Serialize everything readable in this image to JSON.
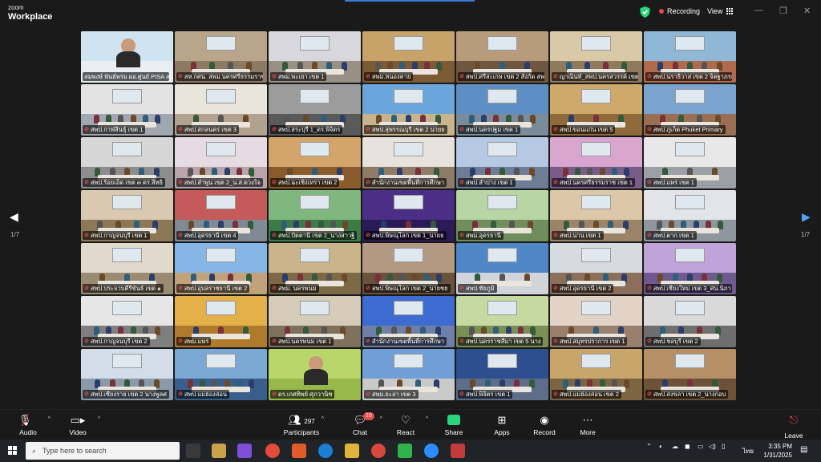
{
  "app": {
    "brand_small": "zoom",
    "brand_big": "Workplace",
    "recording_label": "Recording",
    "view_label": "View"
  },
  "gallery": {
    "page_indicator_left": "1/7",
    "page_indicator_right": "1/7",
    "tiles": [
      {
        "label": "สมพงษ์ พันธ์พรม ผอ.ศูนย์ PISA สพฐ.",
        "kind": "portrait",
        "wall": "#cfe3f0",
        "floor": "#e8eef2",
        "muted": false
      },
      {
        "label": "สห.กศน. สพม.นครศรีธรรมราช",
        "kind": "room",
        "wall": "#b9a58a",
        "floor": "#8c7a63",
        "muted": true
      },
      {
        "label": "สพม.พะเยา เขต 1",
        "kind": "room",
        "wall": "#d8d8dc",
        "floor": "#9a8f84",
        "muted": true
      },
      {
        "label": "สพม.หนองคาย",
        "kind": "room",
        "wall": "#c7a36a",
        "floor": "#7c5a34",
        "muted": true
      },
      {
        "label": "สพป.ศรีสะเกษ เขต 2 สังกัด สพฐ.",
        "kind": "room",
        "wall": "#b89b7b",
        "floor": "#6e5640",
        "muted": true
      },
      {
        "label": "ญาณินท์_สพป.นครสวรรค์ เขต 1",
        "kind": "room",
        "wall": "#d9c9a6",
        "floor": "#8f7a5d",
        "muted": true
      },
      {
        "label": "สพป.นราธิวาส เขต 2 จิตฐาภรณ์",
        "kind": "room",
        "wall": "#8fb7d6",
        "floor": "#b06a4c",
        "muted": true
      },
      {
        "label": "สพป.กาฬสินธุ์ เขต 1",
        "kind": "room",
        "wall": "#e3e3e3",
        "floor": "#a0a7ae",
        "muted": true
      },
      {
        "label": "สพป.สกลนคร เขต 3",
        "kind": "room",
        "wall": "#e9e4dc",
        "floor": "#b2a18f",
        "muted": true
      },
      {
        "label": "สพป.สระบุรี 1_ดร.พิจิตร",
        "kind": "room",
        "wall": "#9c9c9c",
        "floor": "#5a5a5a",
        "muted": true
      },
      {
        "label": "สพป.สุพรรณบุรี เขต 2 นายธ",
        "kind": "room",
        "wall": "#6aa6dc",
        "floor": "#c9b38d",
        "muted": true
      },
      {
        "label": "สพป.นครปฐม เขต 1",
        "kind": "room",
        "wall": "#5d8fc4",
        "floor": "#7a8c99",
        "muted": true
      },
      {
        "label": "สพป.ขอนแก่น เขต 5",
        "kind": "room",
        "wall": "#cfa96a",
        "floor": "#8f6b3c",
        "muted": true
      },
      {
        "label": "สพป.ภูเก็ต Phuket Primary",
        "kind": "room",
        "wall": "#7aa4cf",
        "floor": "#9a6e52",
        "muted": true
      },
      {
        "label": "สพป.ร้อยเอ็ด เขต ๓ ดร.สิทธิ",
        "kind": "room",
        "wall": "#d6d6d6",
        "floor": "#8d8d8d",
        "muted": true
      },
      {
        "label": "สพป.ลำพูน เขต 2_น.ส.ดวงใจ",
        "kind": "room",
        "wall": "#e6dbe0",
        "floor": "#b9a4ac",
        "muted": true
      },
      {
        "label": "สพป.ฉะเชิงเทรา เขต 2",
        "kind": "room",
        "wall": "#d3a56a",
        "floor": "#8a5b2d",
        "muted": true
      },
      {
        "label": "สำนักงานเขตพื้นที่การศึกษา",
        "kind": "room",
        "wall": "#e7e3dc",
        "floor": "#8e7b67",
        "muted": true
      },
      {
        "label": "สพป.ลำปาง เขต 1",
        "kind": "room",
        "wall": "#b6c9e4",
        "floor": "#6d7d95",
        "muted": true
      },
      {
        "label": "สพป.นครศรีธรรมราช เขต 1",
        "kind": "room",
        "wall": "#d9a6d0",
        "floor": "#7a5c88",
        "muted": true
      },
      {
        "label": "สพป.แพร่ เขต 1",
        "kind": "room",
        "wall": "#e8e8e8",
        "floor": "#9aa0a6",
        "muted": true
      },
      {
        "label": "สพป.กาญจนบุรี เขต 1",
        "kind": "room",
        "wall": "#d8c9b0",
        "floor": "#8c7756",
        "muted": true
      },
      {
        "label": "สพป.อุดรธานี เขต 4",
        "kind": "room",
        "wall": "#c45a5a",
        "floor": "#7f8a95",
        "muted": true
      },
      {
        "label": "สพป.ปัตตานี เขต 2_นางสาวฐิ",
        "kind": "room",
        "wall": "#7fb77e",
        "floor": "#3c7a46",
        "muted": true
      },
      {
        "label": "สพป.พิษณุโลก เขต 1_นายธ",
        "kind": "room",
        "wall": "#4b2f86",
        "floor": "#2a1b58",
        "muted": true
      },
      {
        "label": "สพม.อุดรธานี",
        "kind": "room",
        "wall": "#b8d6a4",
        "floor": "#6f8e5c",
        "muted": true
      },
      {
        "label": "สพป.น่าน เขต 1",
        "kind": "room",
        "wall": "#dcc8a8",
        "floor": "#9b8467",
        "muted": true
      },
      {
        "label": "สพป.ตาก เขต 1",
        "kind": "room",
        "wall": "#e2e4e8",
        "floor": "#8e969e",
        "muted": true
      },
      {
        "label": "สพป.ประจวบคีรีขันธ์ เขต ๑",
        "kind": "room",
        "wall": "#e1d9cc",
        "floor": "#9c8b73",
        "muted": true
      },
      {
        "label": "สพป.อุบลราชธานี เขต 2",
        "kind": "room",
        "wall": "#86b6e6",
        "floor": "#c2a27a",
        "muted": true
      },
      {
        "label": "สพม. นครพนม",
        "kind": "room",
        "wall": "#c9b48c",
        "floor": "#7e6947",
        "muted": true
      },
      {
        "label": "สพป.พิษณุโลก เขต 2_นายชย",
        "kind": "room",
        "wall": "#b29a82",
        "floor": "#6a533d",
        "muted": true
      },
      {
        "label": "สพป.ชัยภูมิ",
        "kind": "room",
        "wall": "#4f86c6",
        "floor": "#d0d5dc",
        "muted": true
      },
      {
        "label": "สพป.อุดรธานี เขต 2",
        "kind": "room",
        "wall": "#d6dbe0",
        "floor": "#8b6f5a",
        "muted": true
      },
      {
        "label": "สพป.เชียงใหม่ เขต 3_ศน.นิภา",
        "kind": "room",
        "wall": "#c0a3d9",
        "floor": "#6e5a8f",
        "muted": true
      },
      {
        "label": "สพป.กาญจนบุรี เขต 2",
        "kind": "room",
        "wall": "#e6e6e6",
        "floor": "#7f7f7f",
        "muted": true
      },
      {
        "label": "สพม.แพร่",
        "kind": "room",
        "wall": "#e3b04a",
        "floor": "#b07a2d",
        "muted": true
      },
      {
        "label": "สพป.นครพนม เขต 1",
        "kind": "room",
        "wall": "#d4cbb8",
        "floor": "#7e705a",
        "muted": true
      },
      {
        "label": "สำนักงานเขตพื้นที่การศึกษา",
        "kind": "room",
        "wall": "#3d6bd0",
        "floor": "#6e7fa8",
        "muted": true
      },
      {
        "label": "สพป.นครราชสีมา เขต 5 นาง",
        "kind": "room",
        "wall": "#c6d9a0",
        "floor": "#7a8f54",
        "muted": true
      },
      {
        "label": "สพป.สมุทรปราการ เขต 1",
        "kind": "room",
        "wall": "#e3d3c6",
        "floor": "#9a7f6c",
        "muted": true
      },
      {
        "label": "สพป.ชลบุรี เขต 2",
        "kind": "room",
        "wall": "#d9d9d9",
        "floor": "#6e6e6e",
        "muted": true
      },
      {
        "label": "สพป.เชียงราย เขต 2 นางพูลศ",
        "kind": "room",
        "wall": "#d2dde8",
        "floor": "#8a9aa8",
        "muted": true
      },
      {
        "label": "สพป.แม่ฮ่องสอน",
        "kind": "room",
        "wall": "#7ba8d4",
        "floor": "#3a5f8c",
        "muted": true
      },
      {
        "label": "ดร.เกศทิพย์ ศุภวานิช",
        "kind": "portrait",
        "wall": "#b9d66b",
        "floor": "#97b84a",
        "muted": true
      },
      {
        "label": "สพม.ยะลา เขต 3",
        "kind": "room",
        "wall": "#6f9fd6",
        "floor": "#c9c9c9",
        "muted": true
      },
      {
        "label": "สพป.พิจิตร เขต 1",
        "kind": "room",
        "wall": "#2e4f8f",
        "floor": "#5d6d8a",
        "muted": true
      },
      {
        "label": "สพป.แม่ฮ่องสอน เขต 2",
        "kind": "room",
        "wall": "#c7a56b",
        "floor": "#7d6443",
        "muted": true
      },
      {
        "label": "สพป.สงขลา เขต 2_นางกอบ",
        "kind": "room",
        "wall": "#b58f66",
        "floor": "#6d5239",
        "muted": true
      }
    ]
  },
  "toolbar": {
    "audio": "Audio",
    "video": "Video",
    "participants": "Participants",
    "participants_count": "297",
    "chat": "Chat",
    "chat_badge": "10",
    "react": "React",
    "share": "Share",
    "apps": "Apps",
    "record": "Record",
    "more": "More",
    "leave": "Leave"
  },
  "taskbar": {
    "search_placeholder": "Type here to search",
    "time": "3:35 PM",
    "date": "1/31/2025",
    "lang": "ไทย"
  },
  "colors": {
    "recording_dot": "#e5484d",
    "active_speaker": "#2bd47a",
    "share_green": "#2bd47a"
  }
}
